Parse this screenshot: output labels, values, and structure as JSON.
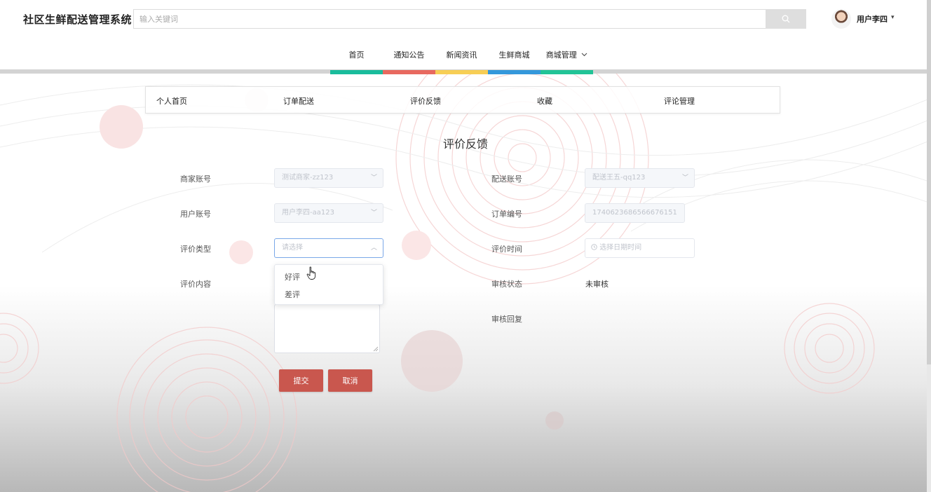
{
  "header": {
    "site_title": "社区生鲜配送管理系统",
    "search_placeholder": "输入关键词",
    "username": "用户李四",
    "user_caret": "▾"
  },
  "nav": {
    "items": [
      {
        "label": "首页",
        "color": "#1abc9c"
      },
      {
        "label": "通知公告",
        "color": "#e8695f"
      },
      {
        "label": "新闻资讯",
        "color": "#f7ce55"
      },
      {
        "label": "生鲜商城",
        "color": "#3498db"
      },
      {
        "label": "商城管理",
        "color": "#22c497"
      }
    ]
  },
  "tabs": [
    "个人首页",
    "订单配送",
    "评价反馈",
    "收藏",
    "评论管理"
  ],
  "page_title": "评价反馈",
  "form": {
    "merchant_label": "商家账号",
    "merchant_value": "测试商家-zz123",
    "courier_label": "配送账号",
    "courier_value": "配送王五-qq123",
    "user_label": "用户账号",
    "user_value": "用户李四-aa123",
    "order_label": "订单编号",
    "order_value": "1740623686566676151",
    "type_label": "评价类型",
    "type_placeholder": "请选择",
    "time_label": "评价时间",
    "time_placeholder": "选择日期时间",
    "content_label": "评价内容",
    "status_label": "审核状态",
    "status_value": "未审核",
    "reply_label": "审核回复",
    "type_options": [
      "好评",
      "差评"
    ],
    "submit_label": "提交",
    "cancel_label": "取消"
  },
  "colors": {
    "accent": "#c9574e",
    "focus_border": "#7aa8e8"
  }
}
